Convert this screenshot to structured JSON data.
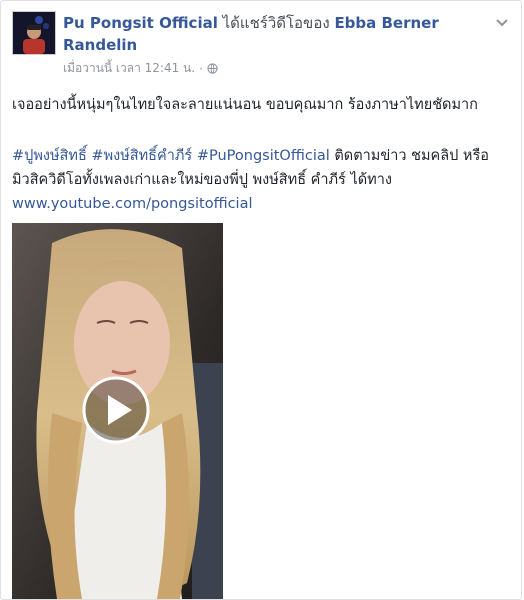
{
  "post": {
    "page_name": "Pu Pongsit Official",
    "action": "ได้แชร์วิดีโอของ",
    "shared_from": "Ebba Berner Randelin",
    "timestamp": "เมื่อวานนี้ เวลา 12:41 น.",
    "separator": "·",
    "privacy_icon": "globe-icon",
    "menu_icon": "chevron-down-icon",
    "message": "เจออย่างนี้หนุ่มๆในไทยใจละลายแน่นอน ขอบคุณมาก ร้องภาษาไทยชัดมาก",
    "hashtags": [
      "#ปูพงษ์สิทธิ์",
      "#พงษ์สิทธิ์คำภีร์",
      "#PuPongsitOfficial"
    ],
    "follow_text": "ติดตามข่าว ชมคลิป หรือมิวสิควิดีโอทั้งเพลงเก่าและใหม่ของพี่ปู พงษ์สิทธิ์ คำภีร์ ได้ทาง",
    "url": "www.youtube.com/pongsitofficial",
    "video": {
      "play_icon": "play-icon"
    }
  },
  "colors": {
    "link": "#365899",
    "meta": "#90949c",
    "text": "#1d2129"
  }
}
